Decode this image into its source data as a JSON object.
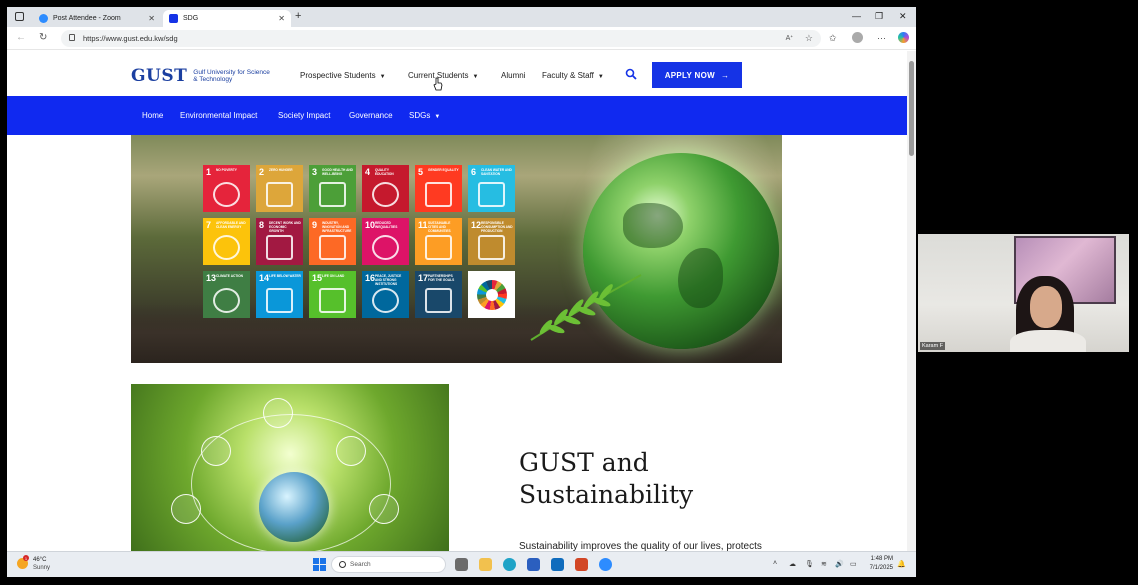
{
  "browser": {
    "tabs": [
      {
        "label": "Post Attendee - Zoom",
        "icon": "zoom-icon",
        "color": "#2d8cff"
      },
      {
        "label": "SDG",
        "icon": "gust-favicon",
        "color": "#1533e6"
      }
    ],
    "url": "https://www.gust.edu.kw/sdg"
  },
  "site": {
    "logo_word": "GUST",
    "logo_subtitle": "Gulf University for Science & Technology",
    "nav": [
      {
        "label": "Prospective Students",
        "dropdown": true
      },
      {
        "label": "Current Students",
        "dropdown": true
      },
      {
        "label": "Alumni",
        "dropdown": false
      },
      {
        "label": "Faculty & Staff",
        "dropdown": true
      }
    ],
    "apply_label": "APPLY NOW",
    "subnav": [
      {
        "label": "Home"
      },
      {
        "label": "Environmental Impact"
      },
      {
        "label": "Society Impact"
      },
      {
        "label": "Governance"
      },
      {
        "label": "SDGs",
        "dropdown": true
      }
    ],
    "colors": {
      "brand_blue": "#1029f0",
      "logo_blue": "#1b3fa0"
    }
  },
  "sdgs": [
    {
      "num": "1",
      "title": "No poverty",
      "color": "#e5243b"
    },
    {
      "num": "2",
      "title": "Zero hunger",
      "color": "#dda63a"
    },
    {
      "num": "3",
      "title": "Good health and well-being",
      "color": "#4c9f38"
    },
    {
      "num": "4",
      "title": "Quality education",
      "color": "#c5192d"
    },
    {
      "num": "5",
      "title": "Gender equality",
      "color": "#ff3a21"
    },
    {
      "num": "6",
      "title": "Clean water and sanitation",
      "color": "#26bde2"
    },
    {
      "num": "7",
      "title": "Affordable and clean energy",
      "color": "#fcc30b"
    },
    {
      "num": "8",
      "title": "Decent work and economic growth",
      "color": "#a21942"
    },
    {
      "num": "9",
      "title": "Industry, innovation and infrastructure",
      "color": "#fd6925"
    },
    {
      "num": "10",
      "title": "Reduced inequalities",
      "color": "#dd1367"
    },
    {
      "num": "11",
      "title": "Sustainable cities and communities",
      "color": "#fd9d24"
    },
    {
      "num": "12",
      "title": "Responsible consumption and production",
      "color": "#bf8b2e"
    },
    {
      "num": "13",
      "title": "Climate action",
      "color": "#3f7e44"
    },
    {
      "num": "14",
      "title": "Life below water",
      "color": "#0a97d9"
    },
    {
      "num": "15",
      "title": "Life on land",
      "color": "#56c02b"
    },
    {
      "num": "16",
      "title": "Peace, justice and strong institutions",
      "color": "#00689d"
    },
    {
      "num": "17",
      "title": "Partnerships for the goals",
      "color": "#19486a"
    }
  ],
  "section": {
    "title_line1": "GUST and",
    "title_line2": "Sustainability",
    "body": "Sustainability improves the quality of our lives, protects"
  },
  "video": {
    "participant_name": "Karam F"
  },
  "taskbar": {
    "weather_temp": "46°C",
    "weather_condition": "Sunny",
    "weather_badge": "1",
    "search_placeholder": "Search",
    "time": "1:48 PM",
    "date": "7/1/2025"
  }
}
